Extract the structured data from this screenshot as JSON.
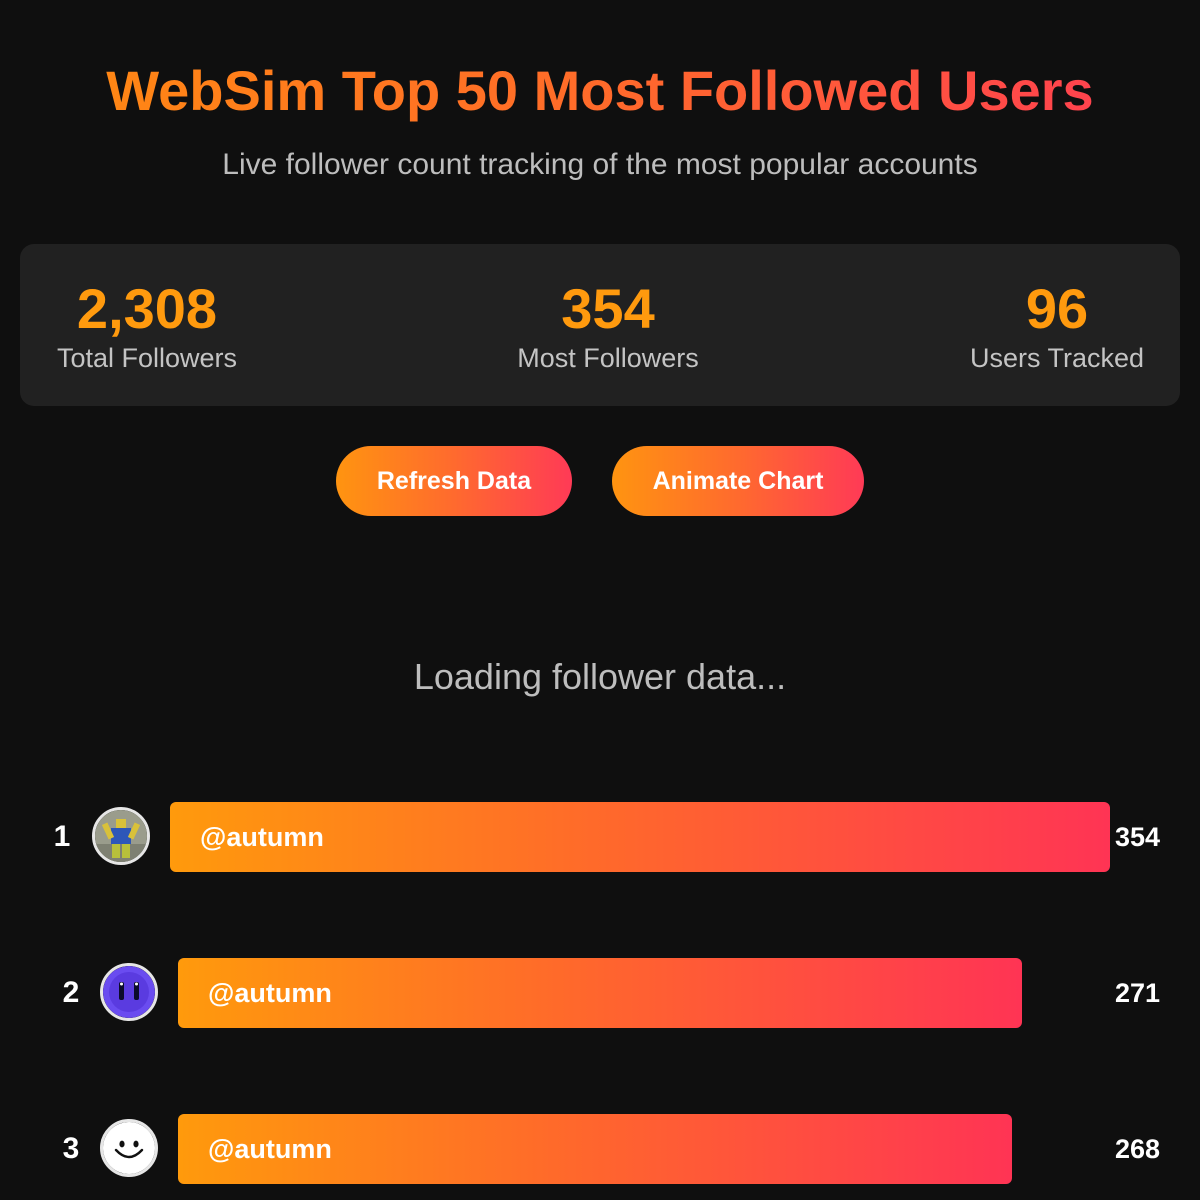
{
  "header": {
    "title": "WebSim Top 50 Most Followed Users",
    "subtitle": "Live follower count tracking of the most popular accounts"
  },
  "stats": [
    {
      "value": "2,308",
      "label": "Total Followers"
    },
    {
      "value": "354",
      "label": "Most Followers"
    },
    {
      "value": "96",
      "label": "Users Tracked"
    }
  ],
  "buttons": {
    "refresh_label": "Refresh Data",
    "animate_label": "Animate Chart"
  },
  "loading_text": "Loading follower data...",
  "leaderboard": [
    {
      "rank": "1",
      "username": "@autumn",
      "followers": "354",
      "avatar": "yellow-figure-avatar"
    },
    {
      "rank": "2",
      "username": "@autumn",
      "followers": "271",
      "avatar": "purple-face-avatar"
    },
    {
      "rank": "3",
      "username": "@autumn",
      "followers": "268",
      "avatar": "smiley-face-avatar"
    }
  ],
  "colors": {
    "background": "#0f0f0f",
    "panel": "#212121",
    "accent_orange": "#ff9a0e",
    "accent_pink": "#ff3a56"
  }
}
